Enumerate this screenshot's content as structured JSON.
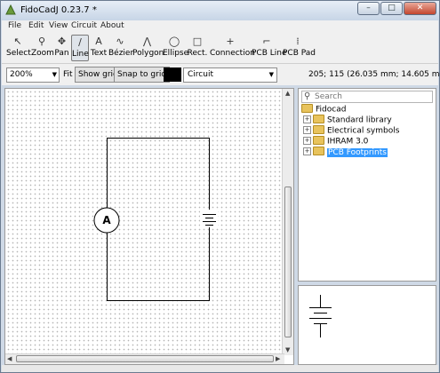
{
  "window": {
    "title": "FidoCadJ 0.23.7  *",
    "minimize": "–",
    "maximize": "□",
    "close": "✕"
  },
  "menu": [
    "File",
    "Edit",
    "View",
    "Circuit",
    "About"
  ],
  "toolbar": [
    {
      "label": "Select",
      "icon": "pointer-icon",
      "glyph": "↖"
    },
    {
      "label": "Zoom",
      "icon": "magnifier-icon",
      "glyph": "⚲"
    },
    {
      "label": "Pan",
      "icon": "move-icon",
      "glyph": "✥"
    },
    {
      "label": "Line",
      "icon": "line-icon",
      "glyph": "∕",
      "active": true
    },
    {
      "label": "Text",
      "icon": "text-icon",
      "glyph": "A"
    },
    {
      "label": "Bézier",
      "icon": "bezier-icon",
      "glyph": "∿"
    },
    {
      "label": "Polygon",
      "icon": "polygon-icon",
      "glyph": "⋀"
    },
    {
      "label": "Ellipse",
      "icon": "ellipse-icon",
      "glyph": "◯"
    },
    {
      "label": "Rect.",
      "icon": "rectangle-icon",
      "glyph": "□"
    },
    {
      "label": "Connection",
      "icon": "connection-icon",
      "glyph": "+"
    },
    {
      "label": "PCB Line",
      "icon": "pcb-line-icon",
      "glyph": "⌐"
    },
    {
      "label": "PCB Pad",
      "icon": "pcb-pad-icon",
      "glyph": "⁞"
    }
  ],
  "options": {
    "zoom": "200%",
    "fit": "Fit",
    "show_grid": "Show grid",
    "snap_to_grid": "Snap to grid",
    "layer": "Circuit",
    "layer_color": "#000000",
    "coordinates": "205; 115 (26.035 mm; 14.605 mm)"
  },
  "search": {
    "placeholder": "Search"
  },
  "library_tree": {
    "root": "Fidocad",
    "items": [
      "Standard library",
      "Electrical symbols",
      "IHRAM 3.0",
      "PCB Footprints"
    ],
    "selected": "PCB Footprints"
  },
  "circuit": {
    "ammeter_label": "A"
  },
  "colors": {
    "selection": "#3399ff",
    "folder": "#e8c35c"
  }
}
